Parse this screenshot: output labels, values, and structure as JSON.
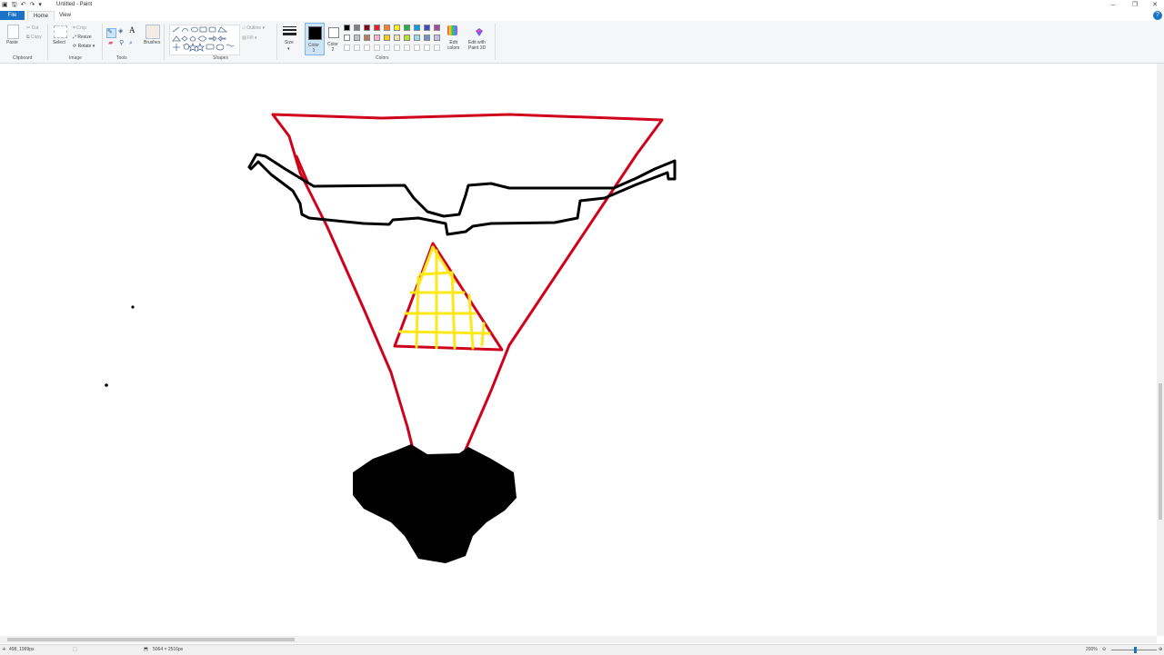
{
  "window": {
    "title": "Untitled - Paint",
    "minimize": "–",
    "restore": "❐",
    "close": "✕"
  },
  "quick_access": {
    "save_icon": "save-icon",
    "undo_icon": "undo-icon",
    "redo_icon": "redo-icon",
    "dropdown": "▾"
  },
  "menu": {
    "file": "File",
    "home": "Home",
    "view": "View"
  },
  "ribbon": {
    "clipboard": {
      "paste": "Paste",
      "cut": "Cut",
      "copy": "Copy",
      "group": "Clipboard"
    },
    "image": {
      "select": "Select",
      "crop": "Crop",
      "resize": "Resize",
      "rotate": "Rotate",
      "group": "Image"
    },
    "tools": {
      "brushes": "Brushes",
      "group": "Tools",
      "text_glyph": "A"
    },
    "shapes": {
      "outline": "Outline",
      "fill": "Fill",
      "group": "Shapes"
    },
    "size": {
      "label": "Size"
    },
    "colors": {
      "color1": "Color\n1",
      "color2": "Color\n2",
      "edit_colors": "Edit\ncolors",
      "edit_3d": "Edit with\nPaint 3D",
      "group": "Colors",
      "active_color1": "#000000",
      "active_color2": "#ffffff",
      "palette": [
        "#000000",
        "#7f7f7f",
        "#880015",
        "#ed1c24",
        "#ff7f27",
        "#fff200",
        "#22b14c",
        "#00a2e8",
        "#3f48cc",
        "#a349a4",
        "#ffffff",
        "#c3c3c3",
        "#b97a57",
        "#ffaec9",
        "#ffc90e",
        "#efe4b0",
        "#b5e61d",
        "#99d9ea",
        "#7092be",
        "#c8bfe7"
      ]
    }
  },
  "drawing": {
    "outline_color": "#d0021b",
    "stroke_color": "#000000",
    "grid_color": "#ffe81a"
  },
  "status": {
    "cursor_pos": "498, 1999px",
    "selection_size": "",
    "canvas_size": "5064 × 2516px",
    "zoom": "200%"
  }
}
